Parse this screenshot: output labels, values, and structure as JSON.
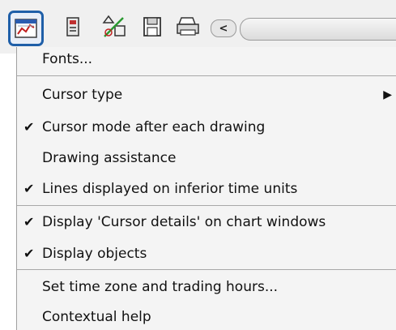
{
  "toolbar": {
    "buttons": [
      {
        "icon": "chart-properties-icon"
      },
      {
        "icon": "object-list-icon"
      },
      {
        "icon": "drawing-tools-icon"
      },
      {
        "icon": "save-icon"
      },
      {
        "icon": "print-icon"
      }
    ],
    "scroll_left_icon": "chevron-left-icon"
  },
  "menu": {
    "items": [
      {
        "label": "Fonts...",
        "checked": false
      },
      {
        "label": "Cursor type",
        "checked": false,
        "submenu": true
      },
      {
        "label": "Cursor mode after each drawing",
        "checked": true
      },
      {
        "label": "Drawing assistance",
        "checked": false
      },
      {
        "label": "Lines displayed on inferior time units",
        "checked": true
      },
      {
        "label": "Display 'Cursor details' on chart windows",
        "checked": true
      },
      {
        "label": "Display objects",
        "checked": true
      },
      {
        "label": "Set time zone and trading hours...",
        "checked": false
      },
      {
        "label": "Contextual help",
        "checked": false
      }
    ],
    "check_glyph": "✔",
    "submenu_glyph": "▶"
  }
}
